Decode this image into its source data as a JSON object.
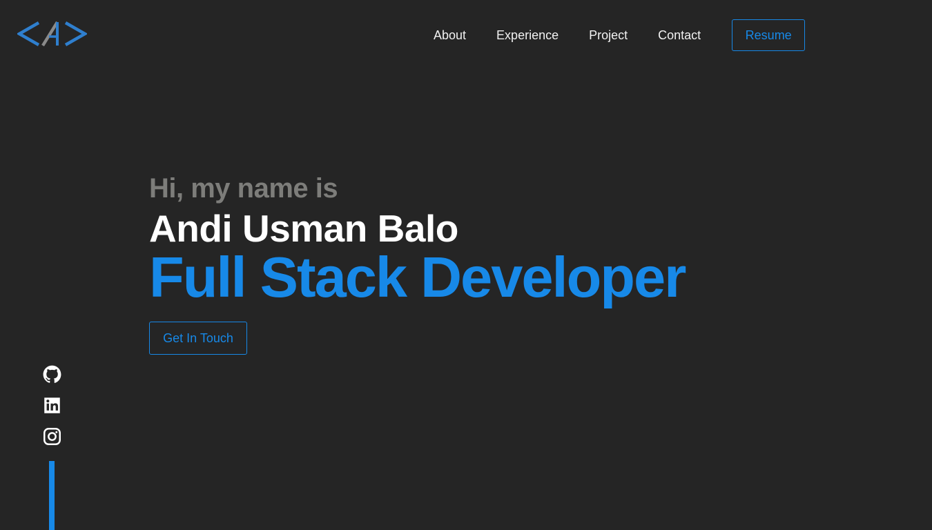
{
  "header": {
    "logo_icon": "code-brackets-a-logo",
    "nav": [
      {
        "label": "About"
      },
      {
        "label": "Experience"
      },
      {
        "label": "Project"
      },
      {
        "label": "Contact"
      }
    ],
    "resume_label": "Resume"
  },
  "hero": {
    "greeting": "Hi, my name is",
    "name": "Andi Usman Balo",
    "role": "Full Stack Developer",
    "cta_label": "Get In Touch"
  },
  "social": [
    {
      "icon": "github-icon"
    },
    {
      "icon": "linkedin-icon"
    },
    {
      "icon": "instagram-icon"
    }
  ],
  "colors": {
    "background": "#252525",
    "accent": "#1789e8",
    "logo_blue": "#2f7fce",
    "logo_gray": "#8a8a8a",
    "muted": "#7d7d7a",
    "text": "#ffffff"
  }
}
